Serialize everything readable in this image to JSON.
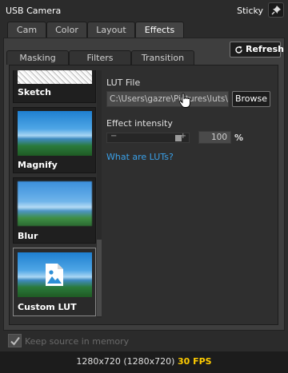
{
  "window": {
    "title": "USB Camera",
    "sticky_label": "Sticky",
    "pin_icon": "pin-icon"
  },
  "main_tabs": [
    {
      "label": "Cam",
      "active": false
    },
    {
      "label": "Color",
      "active": false
    },
    {
      "label": "Layout",
      "active": false
    },
    {
      "label": "Effects",
      "active": true
    }
  ],
  "refresh_label": "Refresh",
  "sub_tabs": [
    {
      "label": "Masking",
      "active": false
    },
    {
      "label": "Filters",
      "active": false
    },
    {
      "label": "Transition",
      "active": false
    }
  ],
  "filters": [
    {
      "label": "Sketch",
      "selected": false
    },
    {
      "label": "Magnify",
      "selected": false
    },
    {
      "label": "Blur",
      "selected": false
    },
    {
      "label": "Custom LUT",
      "selected": true
    }
  ],
  "lut": {
    "file_label": "LUT File",
    "file_value": "C:\\Users\\gazre\\Pictures\\luts\\g",
    "browse_label": "Browse",
    "intensity_label": "Effect intensity",
    "intensity_value": "100",
    "intensity_fraction": 0.9,
    "percent_sign": "%",
    "minus": "−",
    "plus": "+",
    "help_link": "What are LUTs?"
  },
  "keep_source": {
    "label": "Keep source in memory",
    "checked": true
  },
  "status": {
    "resolution": "1280x720 (1280x720)",
    "fps": "30 FPS"
  },
  "colors": {
    "accent_link": "#3aa0e8",
    "fps": "#ffcc00"
  }
}
